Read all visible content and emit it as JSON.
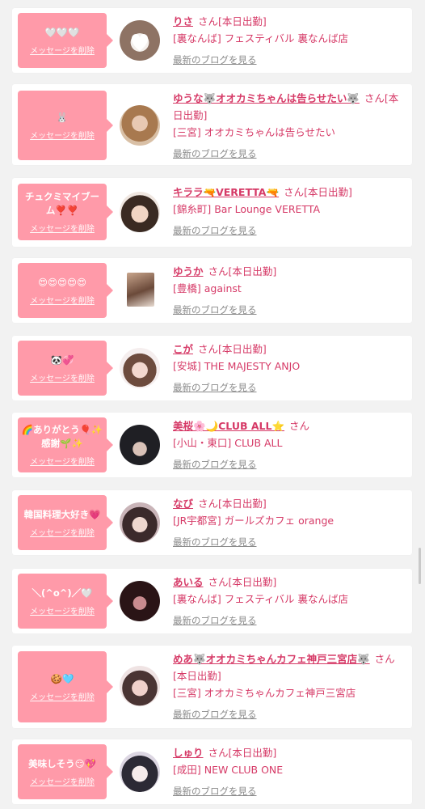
{
  "delete_label": "メッセージを削除",
  "blog_label": "最新のブログを見る",
  "colors": {
    "bubble": "#ff9aa9",
    "accent": "#d63a67",
    "muted": "#8a8a8a"
  },
  "entries": [
    {
      "message": "🤍🤍🤍",
      "name": "りさ",
      "suffix": "さん[本日出勤]",
      "shop": "[裏なんば] フェスティバル 裏なんば店"
    },
    {
      "message": "🐰",
      "name": "ゆうな🐺オオカミちゃんは告らせたい🐺",
      "suffix": "さん[本日出勤]",
      "shop": "[三宮] オオカミちゃんは告らせたい"
    },
    {
      "message": "チュクミマイブーム❣️❣️",
      "name": "キララ🔫VERETTA🔫",
      "suffix": "さん[本日出勤]",
      "shop": "[錦糸町] Bar Lounge VERETTA"
    },
    {
      "message": "😍😍😍😍😍",
      "name": "ゆうか",
      "suffix": "さん[本日出勤]",
      "shop": "[豊橋] against"
    },
    {
      "message": "🐼💞",
      "name": "こが",
      "suffix": "さん[本日出勤]",
      "shop": "[安城] THE MAJESTY ANJO"
    },
    {
      "message": "🌈ありがとう🎈✨感謝🌱✨",
      "name": "美桜🌸🌙CLUB ALL⭐",
      "suffix": "さん",
      "shop": "[小山・東口] CLUB ALL"
    },
    {
      "message": "韓国料理大好き💗",
      "name": "なび",
      "suffix": "さん[本日出勤]",
      "shop": "[JR宇都宮] ガールズカフェ orange"
    },
    {
      "message": "＼(^o^)／🤍",
      "name": "あいる",
      "suffix": "さん[本日出勤]",
      "shop": "[裏なんば] フェスティバル 裏なんば店"
    },
    {
      "message": "🍪🩵",
      "name": "めあ🐺オオカミちゃんカフェ神戸三宮店🐺",
      "suffix": "さん[本日出勤]",
      "shop": "[三宮] オオカミちゃんカフェ神戸三宮店"
    },
    {
      "message": "美味しそう😏💖",
      "name": "しゅり",
      "suffix": "さん[本日出勤]",
      "shop": "[成田] NEW CLUB ONE"
    }
  ]
}
